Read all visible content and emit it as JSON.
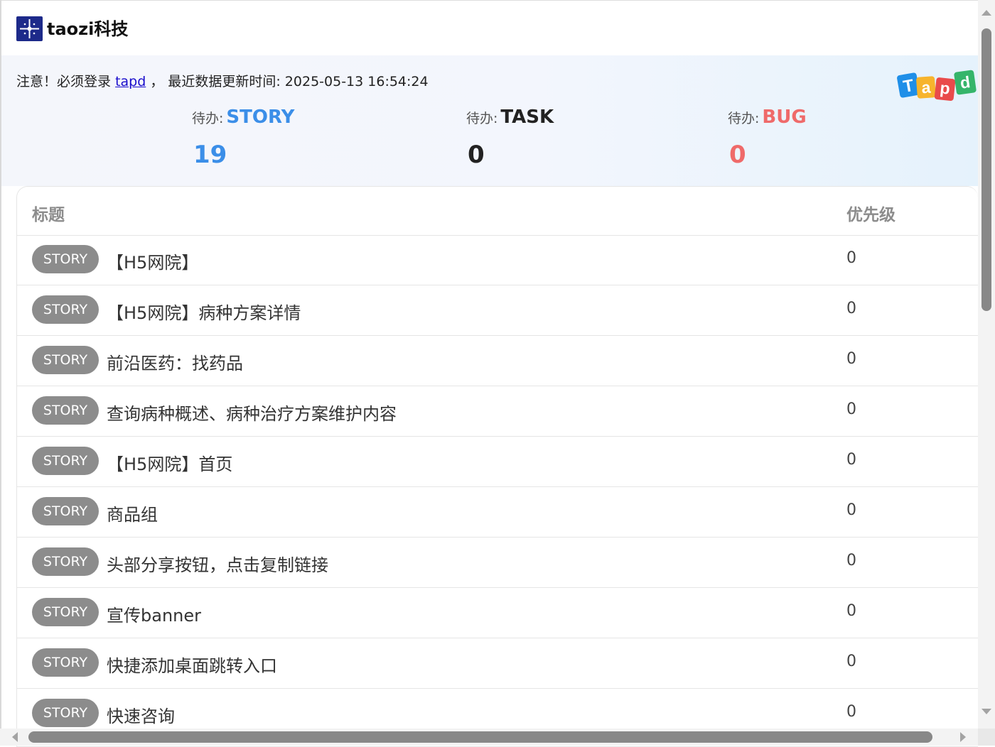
{
  "app": {
    "brand": "taozi科技",
    "logo_icon": "sparkle-logo-icon"
  },
  "notice": {
    "prefix": "注意！必须登录",
    "link": "tapd",
    "suffix": "， 最近数据更新时间: 2025-05-13 16:54:24"
  },
  "tapd_logo": {
    "letters": [
      "T",
      "a",
      "p",
      "d"
    ],
    "colors": [
      "#1f8fe8",
      "#f7b42c",
      "#e94b4b",
      "#35b56a"
    ]
  },
  "stats": {
    "story": {
      "label": "待办:",
      "kind": "STORY",
      "count": "19",
      "color": "#3b8ee8"
    },
    "task": {
      "label": "待办:",
      "kind": "TASK",
      "count": "0",
      "color": "#222222"
    },
    "bug": {
      "label": "待办:",
      "kind": "BUG",
      "count": "0",
      "color": "#ef6a6a"
    }
  },
  "table": {
    "headers": {
      "title": "标题",
      "priority": "优先级"
    },
    "rows": [
      {
        "type": "STORY",
        "title": "【H5网院】",
        "priority": "0"
      },
      {
        "type": "STORY",
        "title": "【H5网院】病种方案详情",
        "priority": "0"
      },
      {
        "type": "STORY",
        "title": "前沿医药：找药品",
        "priority": "0"
      },
      {
        "type": "STORY",
        "title": "查询病种概述、病种治疗方案维护内容",
        "priority": "0"
      },
      {
        "type": "STORY",
        "title": "【H5网院】首页",
        "priority": "0"
      },
      {
        "type": "STORY",
        "title": "商品组",
        "priority": "0"
      },
      {
        "type": "STORY",
        "title": "头部分享按钮，点击复制链接",
        "priority": "0"
      },
      {
        "type": "STORY",
        "title": "宣传banner",
        "priority": "0"
      },
      {
        "type": "STORY",
        "title": "快捷添加桌面跳转入口",
        "priority": "0"
      },
      {
        "type": "STORY",
        "title": "快速咨询",
        "priority": "0"
      }
    ]
  }
}
